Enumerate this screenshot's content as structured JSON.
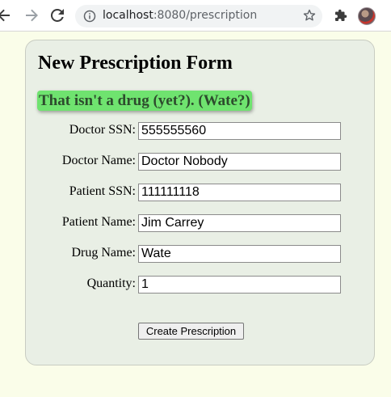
{
  "browser": {
    "url_host": "localhost",
    "url_path": ":8080/prescription"
  },
  "form": {
    "title": "New Prescription Form",
    "alert_message": "That isn't a drug (yet?). (Wate?)",
    "fields": [
      {
        "label": "Doctor SSN:",
        "value": "555555560"
      },
      {
        "label": "Doctor Name:",
        "value": "Doctor Nobody"
      },
      {
        "label": "Patient SSN:",
        "value": "111111118"
      },
      {
        "label": "Patient Name:",
        "value": "Jim Carrey"
      },
      {
        "label": "Drug Name:",
        "value": "Wate"
      },
      {
        "label": "Quantity:",
        "value": "1"
      }
    ],
    "submit_label": "Create Prescription"
  },
  "colors": {
    "page_background": "#fafde9",
    "panel_background": "#e9efe5",
    "alert_background": "#6fe36f",
    "alert_text": "#2d4b2d"
  }
}
